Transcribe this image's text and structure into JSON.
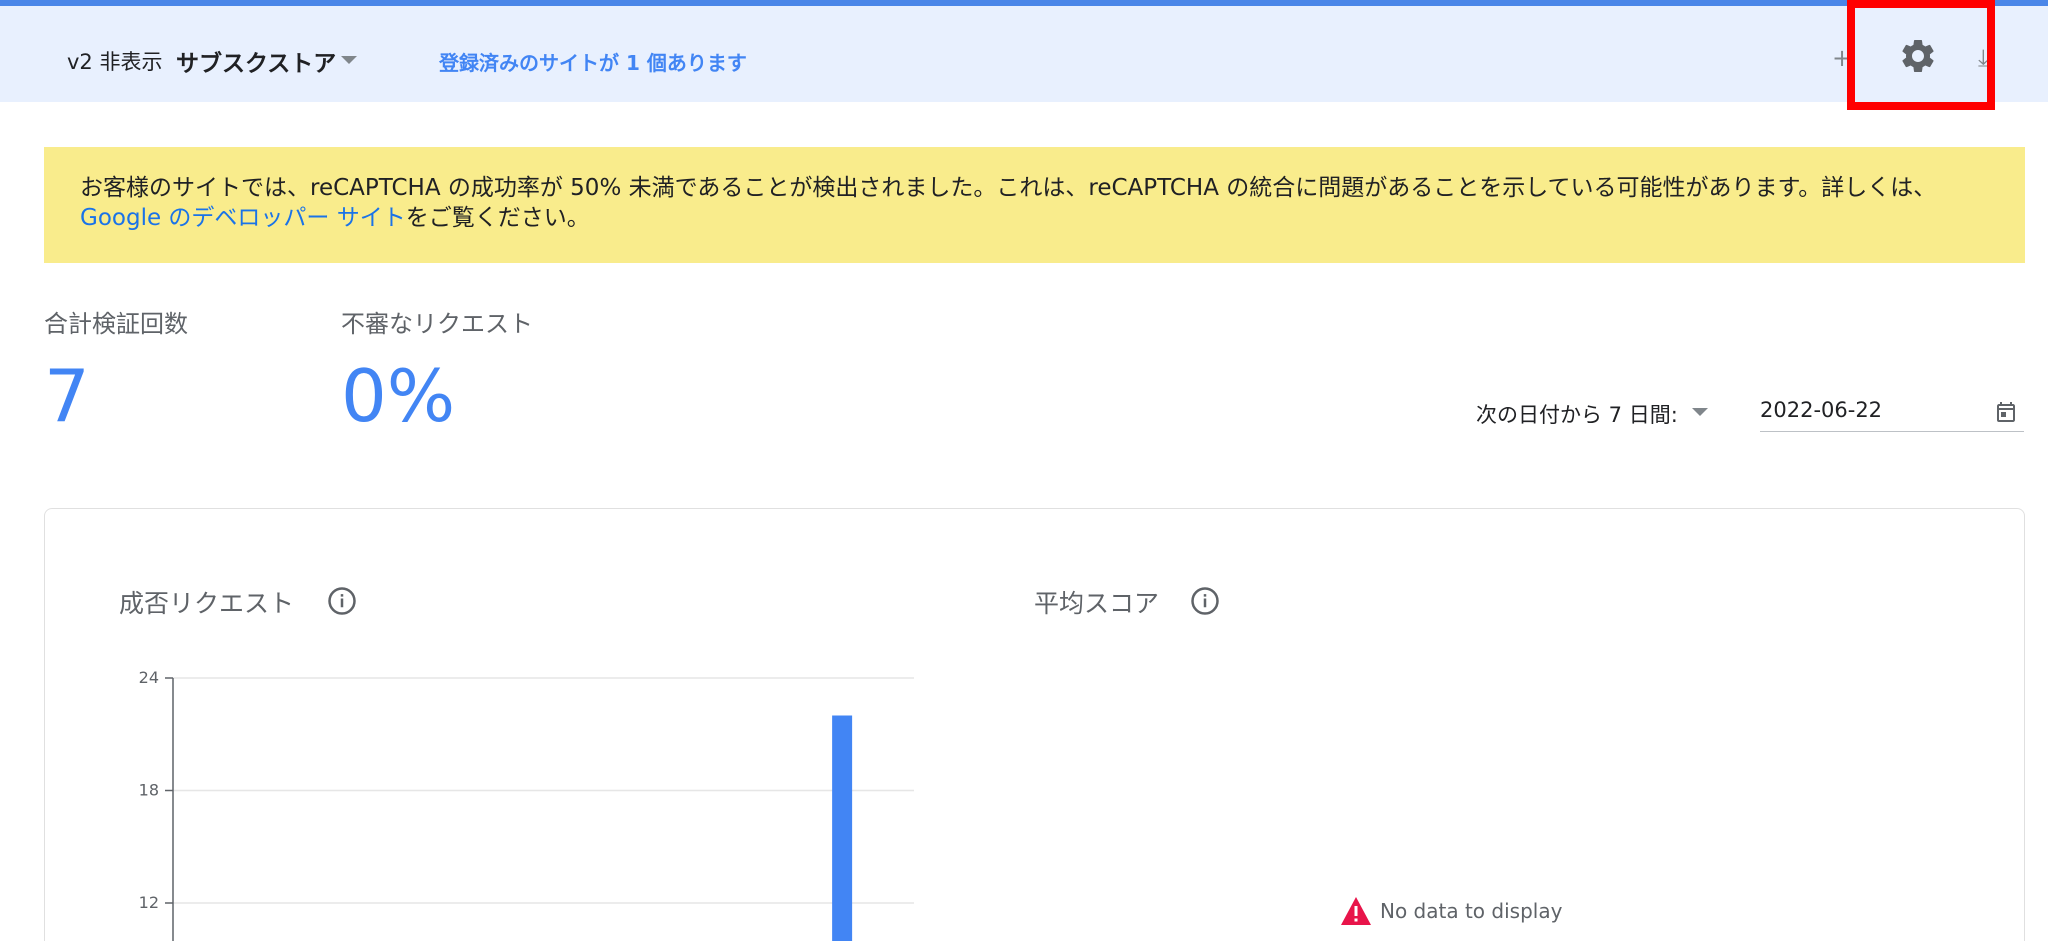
{
  "header": {
    "version_label": "v2 非表示",
    "site_name": "サブスクストア",
    "registered_sites_text": "登録済みのサイトが 1 個あります",
    "left_button_glyph": "+",
    "right_button_glyph": "⤓"
  },
  "alert": {
    "text_before_link": "お客様のサイトでは、reCAPTCHA の成功率が 50% 未満であることが検出されました。これは、reCAPTCHA の統合に問題があることを示している可能性があります。詳しくは、",
    "link_text": "Google のデベロッパー サイト",
    "text_after_link": "をご覧ください。"
  },
  "stats": {
    "total_label": "合計検証回数",
    "total_value": "7",
    "suspicious_label": "不審なリクエスト",
    "suspicious_value": "0%"
  },
  "date_range": {
    "range_label": "次の日付から 7 日間:",
    "date_value": "2022-06-22"
  },
  "cards": {
    "left_title": "成否リクエスト",
    "right_title": "平均スコア",
    "no_data_text": "No data to display"
  },
  "colors": {
    "accent": "#4285f4",
    "header_bg": "#e8f0fe",
    "alert_bg": "#f9ec8c",
    "highlight": "#ff0000",
    "warning": "#e8144a"
  },
  "chart_data": {
    "type": "bar",
    "title": "成否リクエスト",
    "y_ticks": [
      "24",
      "18",
      "12"
    ],
    "ylim": [
      0,
      24
    ],
    "grid": true,
    "bars": [
      {
        "position_fraction": 0.903,
        "value": 22
      }
    ]
  }
}
